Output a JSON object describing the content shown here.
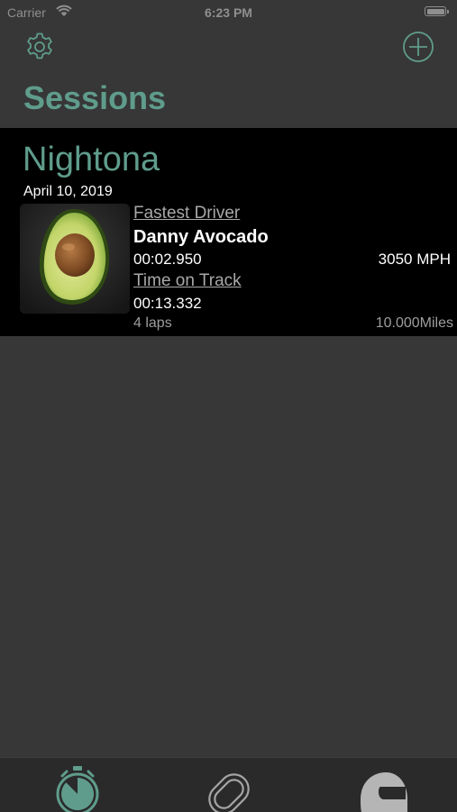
{
  "status_bar": {
    "carrier": "Carrier",
    "time": "6:23 PM"
  },
  "header": {
    "title": "Sessions",
    "settings_icon": "gear-icon",
    "add_icon": "plus-circle-icon"
  },
  "session": {
    "track_name": "Nightona",
    "date": "April 10, 2019",
    "image": "avocado-half",
    "fastest_driver_label": "Fastest Driver",
    "driver_name": "Danny Avocado",
    "best_lap_time": "00:02.950",
    "top_speed": "3050 MPH",
    "time_on_track_label": "Time on Track",
    "time_on_track": "00:13.332",
    "laps": "4 laps",
    "distance": "10.000Miles"
  },
  "tab_bar": {
    "tabs": [
      {
        "icon": "stopwatch-icon",
        "selected": true
      },
      {
        "icon": "race-track-icon",
        "selected": false
      },
      {
        "icon": "helmet-icon",
        "selected": false
      }
    ]
  },
  "colors": {
    "accent": "#5f9c8b",
    "background": "#373737",
    "card": "#000000",
    "tab_bar": "#2a2a2a"
  }
}
